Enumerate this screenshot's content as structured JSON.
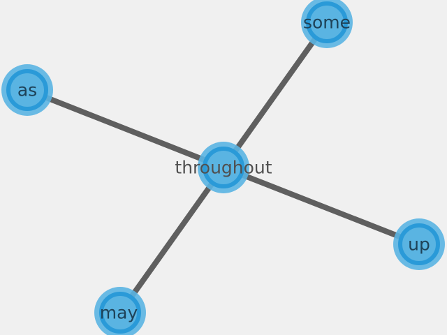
{
  "graph": {
    "colors": {
      "background": "#f0f0f0",
      "edge": "#5f5f5f",
      "node_fill": "#5ab4e2",
      "node_stroke": "#2a9ad8",
      "label": "#1e4258",
      "center_label": "#505050"
    },
    "nodes": [
      {
        "id": "throughout",
        "label": "throughout"
      },
      {
        "id": "some",
        "label": "some"
      },
      {
        "id": "as",
        "label": "as"
      },
      {
        "id": "up",
        "label": "up"
      },
      {
        "id": "may",
        "label": "may"
      }
    ],
    "edges": [
      {
        "from": "throughout",
        "to": "some"
      },
      {
        "from": "throughout",
        "to": "as"
      },
      {
        "from": "throughout",
        "to": "up"
      },
      {
        "from": "throughout",
        "to": "may"
      }
    ]
  }
}
